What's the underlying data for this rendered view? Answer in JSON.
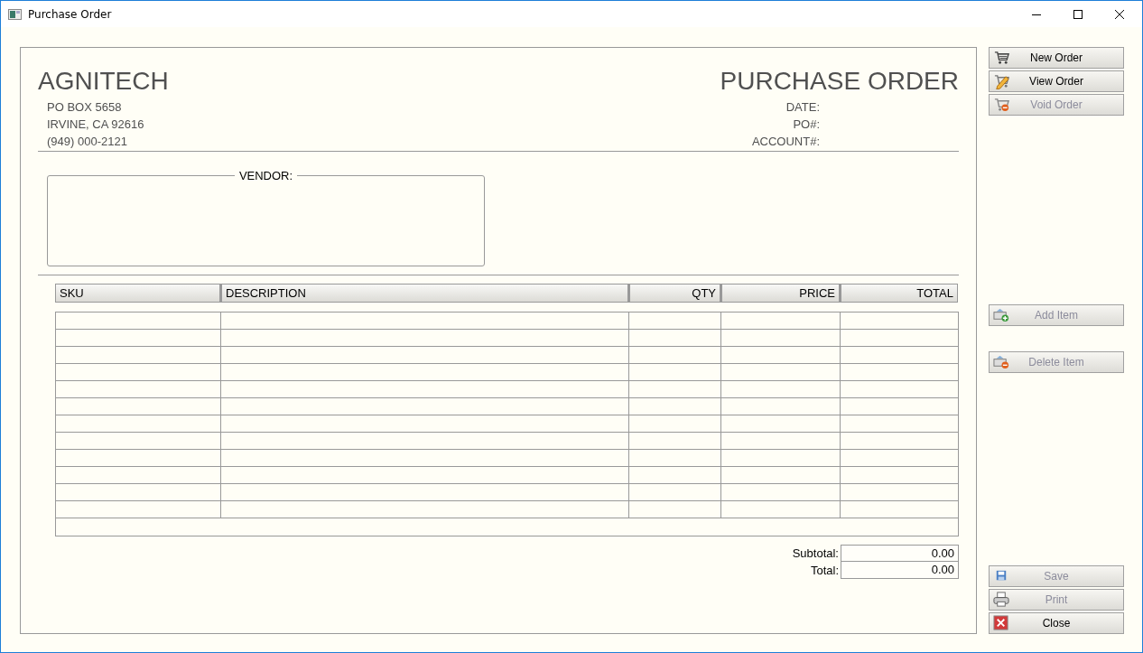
{
  "window": {
    "title": "Purchase Order"
  },
  "company": {
    "name": "AGNITECH",
    "address_lines": [
      "PO BOX 5658",
      "IRVINE, CA 92616",
      "(949) 000-2121"
    ]
  },
  "document": {
    "title": "PURCHASE ORDER",
    "fields": [
      {
        "label": "DATE:"
      },
      {
        "label": "PO#:"
      },
      {
        "label": "ACCOUNT#:"
      }
    ]
  },
  "vendor": {
    "label": "VENDOR:"
  },
  "table": {
    "columns": [
      {
        "label": "SKU",
        "kind": "text"
      },
      {
        "label": "DESCRIPTION",
        "kind": "text"
      },
      {
        "label": "QTY",
        "kind": "numeric"
      },
      {
        "label": "PRICE",
        "kind": "numeric"
      },
      {
        "label": "TOTAL",
        "kind": "numeric"
      }
    ]
  },
  "totals": [
    {
      "label": "Subtotal:",
      "value": "0.00"
    },
    {
      "label": "Total:",
      "value": "0.00"
    }
  ],
  "button_groups": [
    {
      "buttons": [
        {
          "label": "New Order",
          "kind": "new",
          "disabled": false
        },
        {
          "label": "View Order",
          "kind": "view",
          "disabled": false
        },
        {
          "label": "Void Order",
          "kind": "void",
          "disabled": true
        }
      ]
    },
    {
      "buttons": [
        {
          "label": "Add Item",
          "kind": "add",
          "disabled": true
        },
        {
          "label": "Delete Item",
          "kind": "delete",
          "disabled": true
        }
      ]
    },
    {
      "buttons": [
        {
          "label": "Save",
          "kind": "save",
          "disabled": true
        },
        {
          "label": "Print",
          "kind": "print",
          "disabled": true
        },
        {
          "label": "Close",
          "kind": "close",
          "disabled": false
        }
      ]
    }
  ]
}
